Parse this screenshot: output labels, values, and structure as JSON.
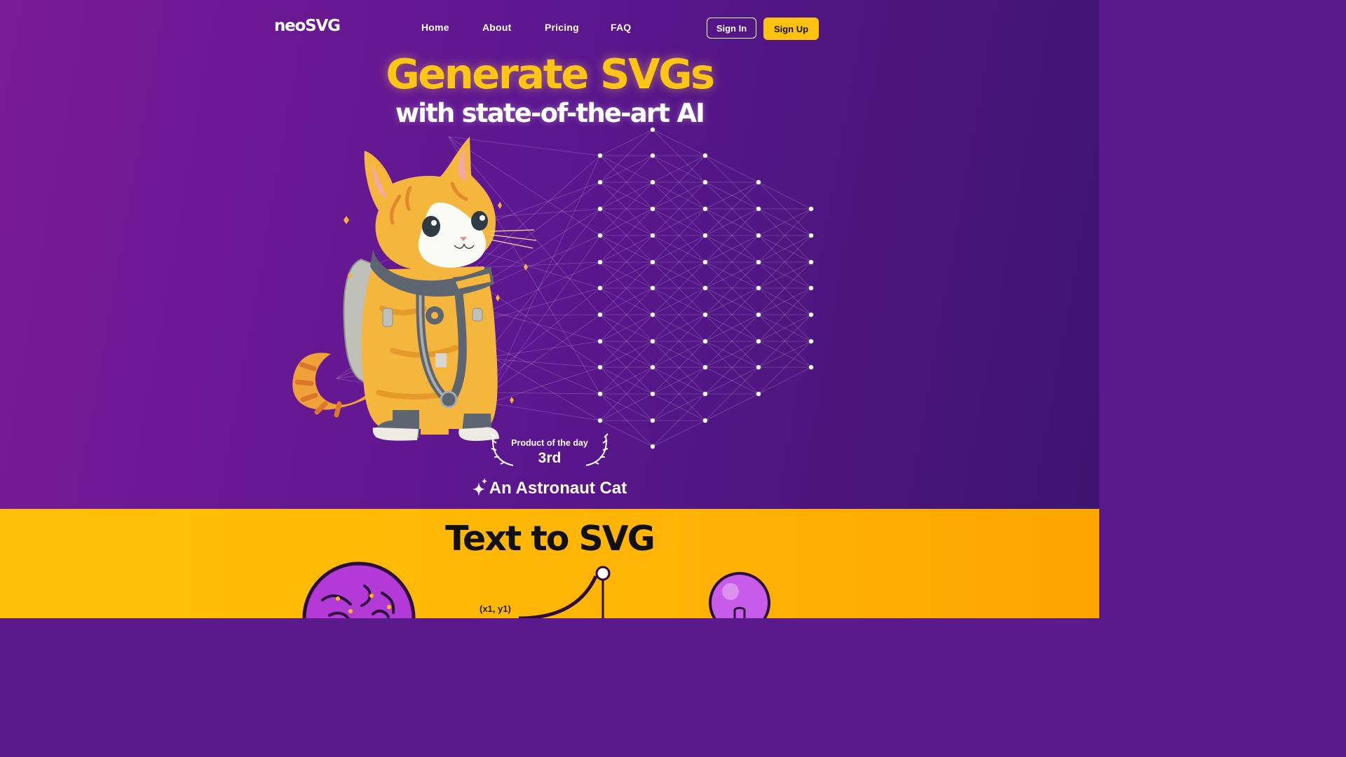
{
  "brand": {
    "logo_text": "neoSVG"
  },
  "nav": {
    "links": [
      "Home",
      "About",
      "Pricing",
      "FAQ"
    ],
    "sign_in": "Sign In",
    "sign_up": "Sign Up"
  },
  "hero": {
    "headline": "Generate SVGs",
    "subheadline": "with state-of-the-art AI",
    "badge": {
      "label": "Product of the day",
      "rank": "3rd"
    },
    "prompt": "An Astronaut Cat"
  },
  "features": {
    "title": "Text to SVG",
    "coord_label": "(x1, y1)"
  },
  "colors": {
    "accent_yellow": "#fdc20f",
    "hero_purple": "#5e1790",
    "features_orange": "#ffb406"
  },
  "icons": [
    "sparkle-icon",
    "laurel-left-icon",
    "laurel-right-icon",
    "brain-icon",
    "lightbulb-icon"
  ]
}
